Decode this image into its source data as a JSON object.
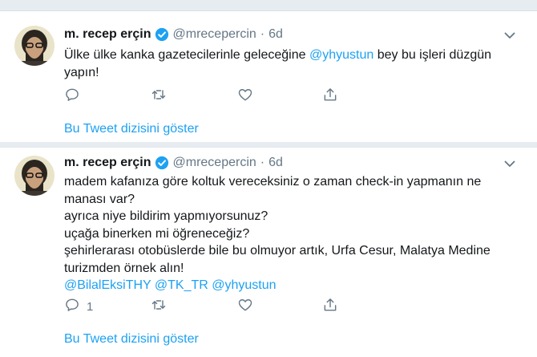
{
  "colors": {
    "accent": "#1da1f2",
    "muted": "#657786",
    "text": "#14171a",
    "divider": "#e6ecf0"
  },
  "tweets": [
    {
      "author_name": "m. recep erçin",
      "handle": "@mrecepercin",
      "separator": "·",
      "time": "6d",
      "verified_icon": "verified-badge-icon",
      "text_before": "Ülke ülke kanka gazetecilerinle geleceğine ",
      "mention": "@yhyustun",
      "text_after": " bey bu işleri düzgün",
      "text_line2": "yapın!",
      "reply_count": "",
      "thread_link": "Bu Tweet dizisini göster"
    },
    {
      "author_name": "m. recep erçin",
      "handle": "@mrecepercin",
      "separator": "·",
      "time": "6d",
      "verified_icon": "verified-badge-icon",
      "lines": [
        "madem kafanıza göre koltuk vereceksiniz o zaman check-in yapmanın ne",
        "manası var?",
        "ayrıca niye bildirim yapmıyorsunuz?",
        "uçağa binerken mi öğreneceğiz?",
        "şehirlerarası otobüslerde bile bu olmuyor artık, Urfa Cesur, Malatya Medine",
        "turizmden örnek alın!"
      ],
      "mentions": [
        "@BilalEksiTHY",
        "@TK_TR",
        "@yhyustun"
      ],
      "reply_count": "1",
      "thread_link": "Bu Tweet dizisini göster"
    }
  ]
}
